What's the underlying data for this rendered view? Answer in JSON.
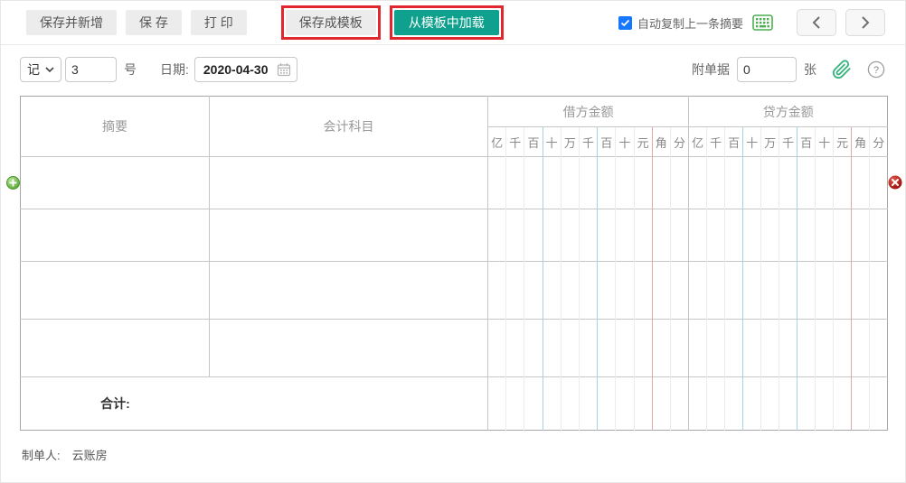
{
  "toolbar": {
    "save_new_label": "保存并新增",
    "save_label": "保 存",
    "print_label": "打 印",
    "save_template_label": "保存成模板",
    "load_template_label": "从模板中加载",
    "auto_copy_label": "自动复制上一条摘要",
    "auto_copy_checked": true
  },
  "voucher_bar": {
    "type_value": "记",
    "number_value": "3",
    "number_unit": "号",
    "date_label": "日期:",
    "date_value": "2020-04-30",
    "attachment_label": "附单据",
    "attachment_value": "0",
    "attachment_unit": "张"
  },
  "table": {
    "summary_header": "摘要",
    "subject_header": "会计科目",
    "debit_header": "借方金额",
    "credit_header": "贷方金额",
    "digit_columns": [
      "亿",
      "千",
      "百",
      "十",
      "万",
      "千",
      "百",
      "十",
      "元",
      "角",
      "分"
    ],
    "total_label": "合计:",
    "body_row_count": 4
  },
  "footer": {
    "preparer_label": "制单人:",
    "preparer_value": "云账房"
  },
  "icons": {
    "keyboard": "keyboard-icon",
    "prev": "chevron-left-icon",
    "next": "chevron-right-icon",
    "paperclip": "paperclip-icon",
    "help": "question-circle-icon",
    "calendar": "calendar-icon",
    "add_row": "plus-circle-icon",
    "delete_row": "delete-circle-icon",
    "select_arrow": "chevron-down-icon",
    "checkbox_check": "check-icon"
  },
  "colors": {
    "accent_teal": "#10a08e",
    "highlight_red": "#e2262d",
    "checkbox_blue": "#1677ff",
    "keyboard_green": "#4caf50",
    "paperclip_green": "#36b37e",
    "digit_separator_blue": "#a9d1e6",
    "digit_separator_red": "#dcacac"
  }
}
